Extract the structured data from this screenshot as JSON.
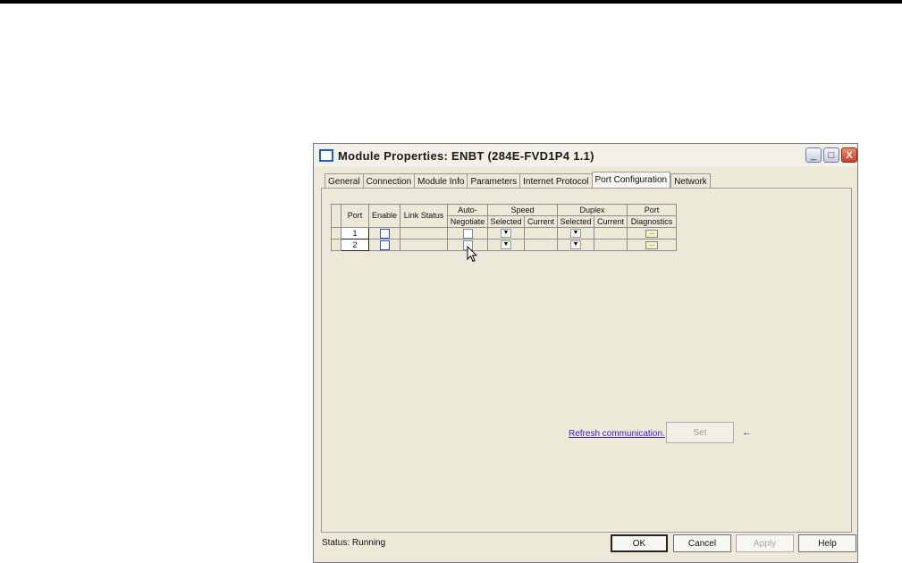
{
  "window": {
    "title": "Module Properties: ENBT (284E-FVD1P4 1.1)",
    "minimize_glyph": "_",
    "maximize_glyph": "□",
    "close_glyph": "X"
  },
  "tabs": [
    {
      "label": "General"
    },
    {
      "label": "Connection"
    },
    {
      "label": "Module Info"
    },
    {
      "label": "Parameters"
    },
    {
      "label": "Internet Protocol"
    },
    {
      "label": "Port Configuration",
      "active": true
    },
    {
      "label": "Network"
    }
  ],
  "table": {
    "headers": {
      "port": "Port",
      "enable": "Enable",
      "link_status": "Link Status",
      "auto_negotiate_1": "Auto-",
      "auto_negotiate_2": "Negotiate",
      "speed": "Speed",
      "duplex": "Duplex",
      "port_diagnostics_1": "Port",
      "port_diagnostics_2": "Diagnostics",
      "selected": "Selected",
      "current": "Current"
    },
    "rows": [
      {
        "port": "1"
      },
      {
        "port": "2"
      }
    ],
    "diag_glyph": "..."
  },
  "footer": {
    "refresh_link": "Refresh communication.",
    "set_label": "Set",
    "arrow_glyph": "←",
    "status": "Status:  Running",
    "ok_label": "OK",
    "cancel_label": "Cancel",
    "apply_label": "Apply",
    "help_label": "Help"
  }
}
